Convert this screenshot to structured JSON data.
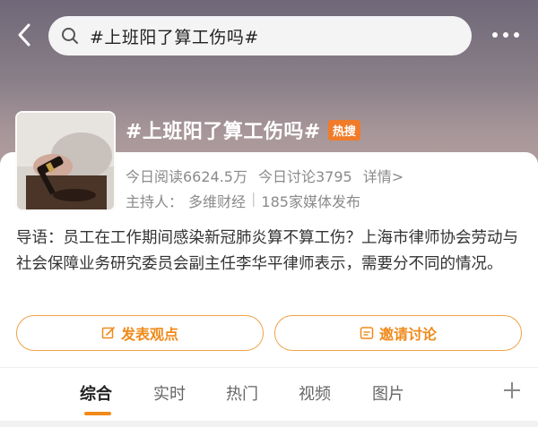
{
  "search": {
    "query": "#上班阳了算工伤吗#"
  },
  "topic": {
    "title": "#上班阳了算工伤吗#",
    "hot_badge": "热搜",
    "reads": "今日阅读6624.5万",
    "discussions": "今日讨论3795",
    "detail_link": "详情>",
    "host_label": "主持人：",
    "host_name": "多维财经",
    "host_sep": "|",
    "media": "185家媒体发布"
  },
  "intro": "导语：员工在工作期间感染新冠肺炎算不算工伤？上海市律师协会劳动与社会保障业务研究委员会副主任李华平律师表示，需要分不同的情况。",
  "actions": {
    "post_label": "发表观点",
    "invite_label": "邀请讨论"
  },
  "tabs": [
    "综合",
    "实时",
    "热门",
    "视频",
    "图片"
  ],
  "icons": {
    "back": "back-arrow-icon",
    "search": "search-icon",
    "more": "more-dots-icon",
    "edit": "edit-icon",
    "invite": "invite-icon",
    "plus": "plus-icon"
  },
  "colors": {
    "accent": "#f08a1a",
    "hot_badge": "#f07c2a"
  }
}
